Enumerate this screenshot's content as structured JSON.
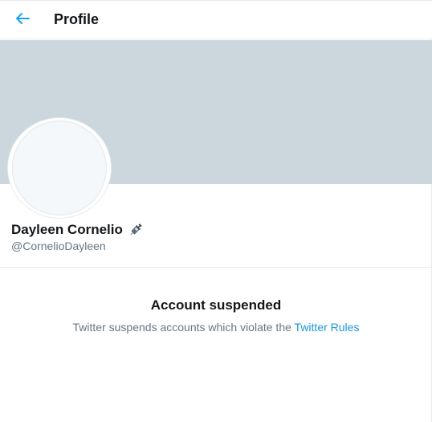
{
  "header": {
    "title": "Profile",
    "back_icon": "arrow-left-icon",
    "accent_color": "#1da1f2"
  },
  "profile": {
    "display_name": "Dayleen Cornelio",
    "name_emoji_icon": "syringe-icon",
    "handle": "@CornelioDayleen",
    "banner_color": "#ccd6dd"
  },
  "notice": {
    "title": "Account suspended",
    "text_prefix": "Twitter suspends accounts which violate the ",
    "link_text": "Twitter Rules",
    "link_color": "#1b95e0"
  }
}
